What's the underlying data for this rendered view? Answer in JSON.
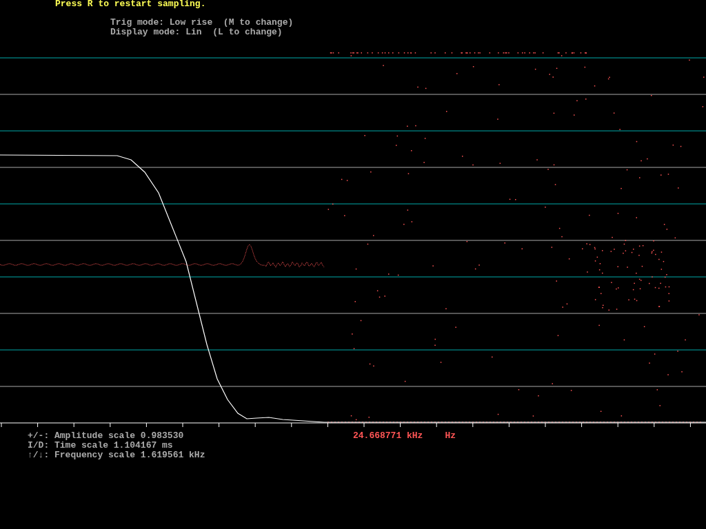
{
  "header": {
    "prompt": "Press R to restart sampling.",
    "trig_mode": "Trig mode: Low rise  (M to change)",
    "display_mode": "Display mode: Lin  (L to change)"
  },
  "footer": {
    "lines": [
      "+/-: Amplitude scale 0.983530",
      "I/D: Time scale 1.104167 ms",
      "↑/↓: Frequency scale 1.619561 kHz"
    ],
    "frequency_readout": "24.668771 kHz",
    "unit": "Hz"
  }
}
